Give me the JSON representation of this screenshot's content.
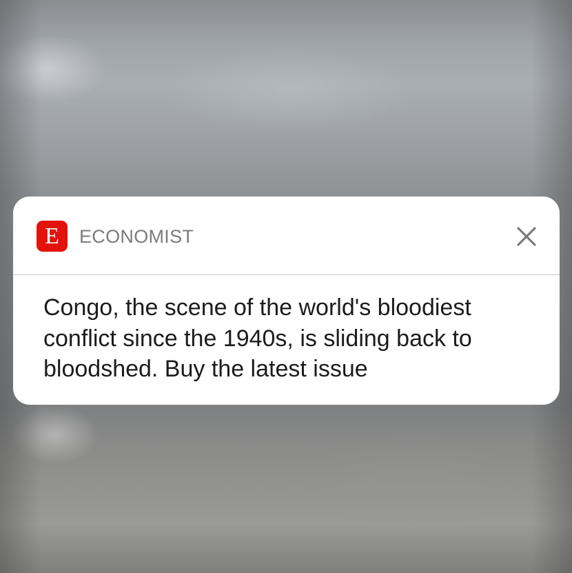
{
  "notification": {
    "app_icon_letter": "E",
    "app_name": "ECONOMIST",
    "close_icon": "close-icon",
    "message": "Congo, the scene of the world's bloodiest conflict since the 1940s, is sliding back to bloodshed. Buy the latest issue"
  },
  "colors": {
    "brand_red": "#e3120b",
    "card_background": "#ffffff",
    "app_name_gray": "#7b7b7e",
    "message_text": "#1c1c1e"
  }
}
